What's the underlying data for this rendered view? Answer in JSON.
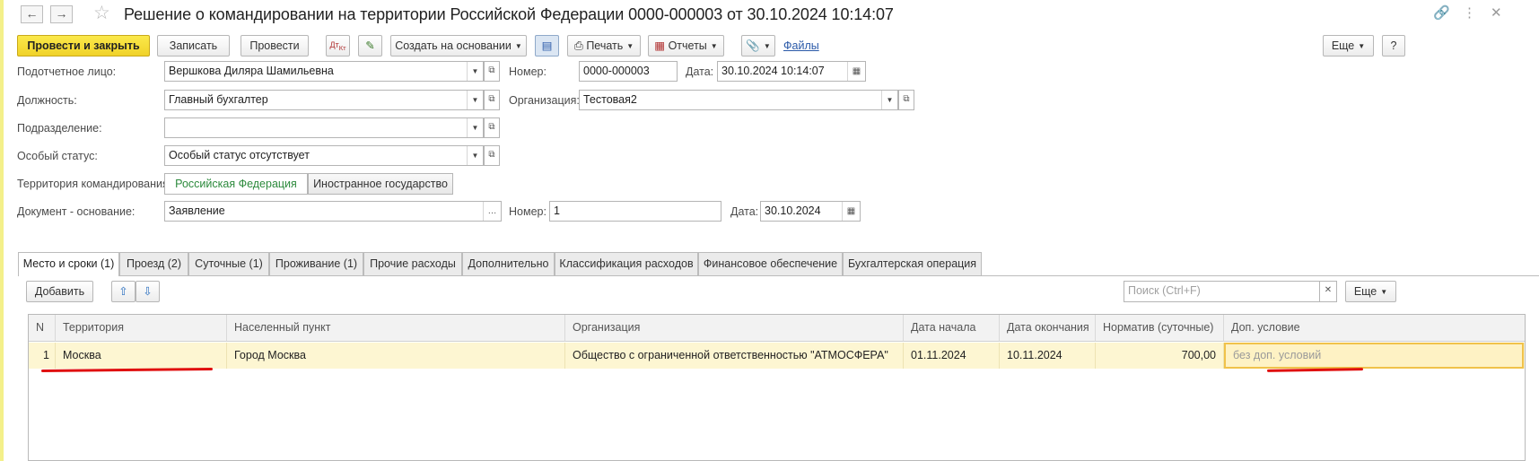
{
  "window": {
    "title": "Решение о командировании на территории Российской Федерации 0000-000003 от 30.10.2024 10:14:07"
  },
  "toolbar": {
    "post_close": "Провести и закрыть",
    "save": "Записать",
    "post": "Провести",
    "create_based": "Создать на основании",
    "print": "Печать",
    "reports": "Отчеты",
    "files": "Файлы",
    "more": "Еще",
    "help": "?"
  },
  "form": {
    "person_label": "Подотчетное лицо:",
    "person_value": "Вершкова Диляра Шамильевна",
    "number_label": "Номер:",
    "number_value": "0000-000003",
    "date_label": "Дата:",
    "date_value": "30.10.2024 10:14:07",
    "position_label": "Должность:",
    "position_value": "Главный бухгалтер",
    "org_label": "Организация:",
    "org_value": "Тестовая2",
    "dept_label": "Подразделение:",
    "dept_value": "",
    "status_label": "Особый статус:",
    "status_value": "Особый статус отсутствует",
    "territory_label": "Территория командирования:",
    "territory_options": [
      "Российская Федерация",
      "Иностранное государство"
    ],
    "basis_label": "Документ - основание:",
    "basis_value": "Заявление",
    "basis_number_label": "Номер:",
    "basis_number_value": "1",
    "basis_date_label": "Дата:",
    "basis_date_value": "30.10.2024"
  },
  "tabs": [
    "Место и сроки (1)",
    "Проезд (2)",
    "Суточные (1)",
    "Проживание (1)",
    "Прочие расходы",
    "Дополнительно",
    "Классификация расходов",
    "Финансовое обеспечение",
    "Бухгалтерская операция"
  ],
  "table_toolbar": {
    "add": "Добавить",
    "search_placeholder": "Поиск (Ctrl+F)",
    "more": "Еще"
  },
  "table": {
    "columns": [
      "N",
      "Территория",
      "Населенный пункт",
      "Организация",
      "Дата начала",
      "Дата окончания",
      "Норматив (суточные)",
      "Доп. условие"
    ],
    "rows": [
      [
        "1",
        "Москва",
        "Город Москва",
        "Общество с ограниченной ответственностью \"АТМОСФЕРА\"",
        "01.11.2024",
        "10.11.2024",
        "700,00",
        "без доп. условий"
      ]
    ]
  },
  "colors": {
    "primary_button": "#f0d22a",
    "selected_row": "#fdf6d2",
    "active_option": "#2c8a3c",
    "annotation": "#e01010"
  }
}
